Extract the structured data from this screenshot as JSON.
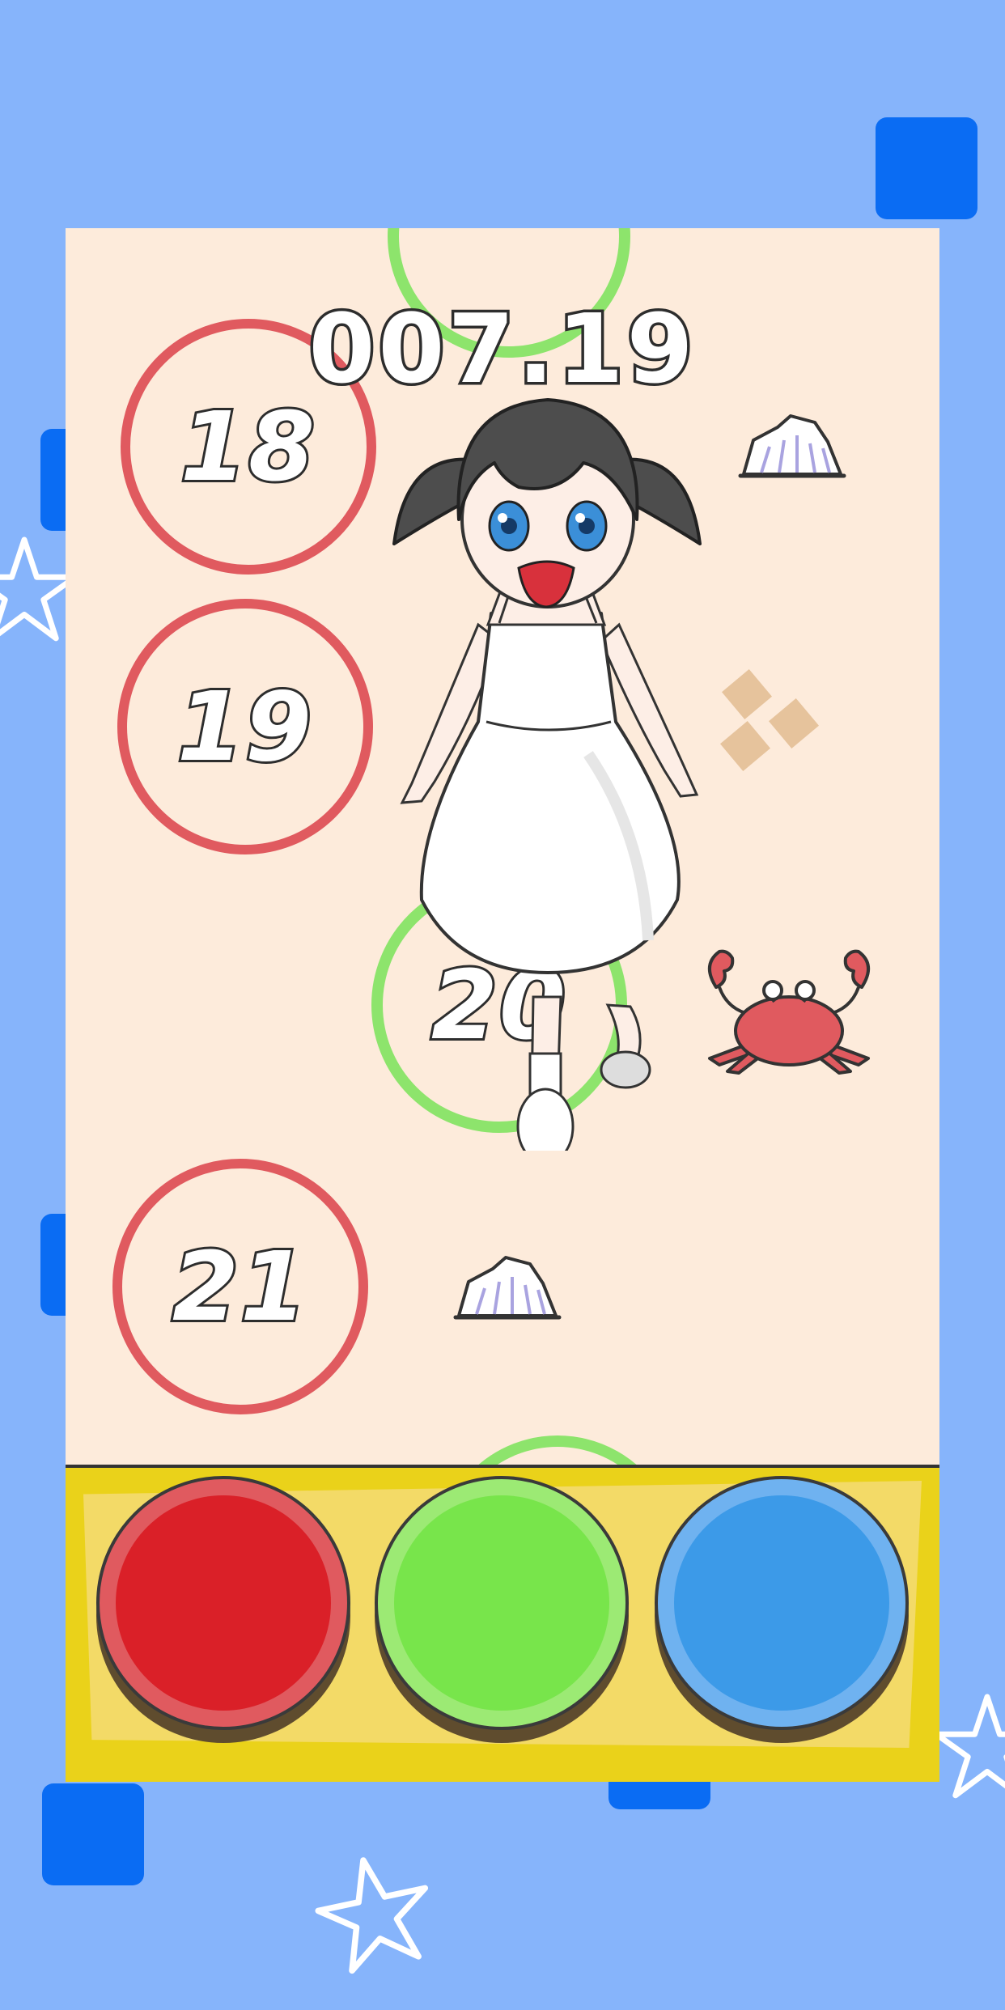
{
  "game": {
    "timer": "007.19",
    "tiles": [
      {
        "number": "18",
        "color": "red"
      },
      {
        "number": "19",
        "color": "red"
      },
      {
        "number": "20",
        "color": "green"
      },
      {
        "number": "21",
        "color": "red"
      }
    ]
  },
  "controls": {
    "buttons": [
      {
        "id": "red",
        "color": "#da2028"
      },
      {
        "id": "green",
        "color": "#78e54b"
      },
      {
        "id": "blue",
        "color": "#3c9ae8"
      }
    ]
  },
  "colors": {
    "background": "#86b4fb",
    "playfield": "#fdebdb",
    "accent_square": "#0a6cf3",
    "tile_red": "#e05a5f",
    "tile_green": "#8de46c",
    "control_panel": "#ead21a"
  },
  "icons": [
    "star-outline-icon",
    "crab-icon",
    "seashell-icon",
    "cookie-crumbs-icon",
    "girl-character"
  ]
}
